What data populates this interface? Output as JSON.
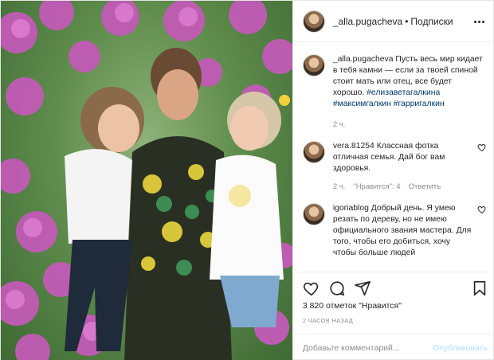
{
  "header": {
    "username": "_alla.pugacheva",
    "separator": "•",
    "follow_label": "Подписки"
  },
  "caption": {
    "username": "_alla.pugacheva",
    "text": "Пусть весь мир кидает в тебя камни — если за твоей спиной стоит мать или отец, все будет хорошо.",
    "tags": "#елизаветагалкина #максимгалкин #гарригалкин",
    "time": "2 ч."
  },
  "comments": [
    {
      "username": "vera.81254",
      "text": "Классная фотка отличная семья. Дай бог вам здоровья.",
      "time": "2 ч.",
      "likes": "\"Нравится\": 4",
      "reply": "Ответить"
    },
    {
      "username": "igoriablog",
      "text": "Добрый день. Я умею резать по дереву, но не имею официального звания мастера. Для того, чтобы его добиться, хочу чтобы больше людей"
    }
  ],
  "likes_count": "3 820 отметок \"Нравится\"",
  "post_time": "2 ЧАСОВ НАЗАД",
  "add_comment": {
    "placeholder": "Добавьте комментарий...",
    "publish_label": "Опубликовать"
  },
  "colors": {
    "text": "#262626",
    "muted": "#8e8e8e",
    "link": "#00376b",
    "publish_disabled": "#b2dffc",
    "flowers": "#c45ab8"
  },
  "icons": {
    "more": "more-options-icon",
    "like": "heart-icon",
    "comment": "comment-icon",
    "share": "share-icon",
    "save": "bookmark-icon"
  }
}
